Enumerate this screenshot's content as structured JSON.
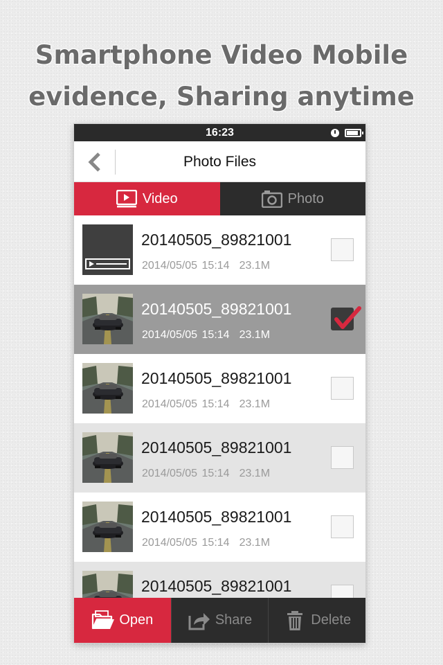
{
  "promo": {
    "line1": "Smartphone Video Mobile",
    "line2": "evidence, Sharing anytime"
  },
  "status_bar": {
    "time": "16:23",
    "icons": [
      "clock-icon",
      "battery-icon"
    ]
  },
  "nav": {
    "back_icon": "chevron-left-icon",
    "title": "Photo Files"
  },
  "tabs": [
    {
      "label": "Video",
      "icon": "video-icon",
      "active": true
    },
    {
      "label": "Photo",
      "icon": "camera-icon",
      "active": false
    }
  ],
  "files": [
    {
      "name": "20140505_89821001",
      "date": "2014/05/05 15:14",
      "size": "23.1M",
      "thumbnail": "video-placeholder",
      "checked": false
    },
    {
      "name": "20140505_89821001",
      "date": "2014/05/05 15:14",
      "size": "23.1M",
      "thumbnail": "car-photo",
      "checked": true
    },
    {
      "name": "20140505_89821001",
      "date": "2014/05/05 15:14",
      "size": "23.1M",
      "thumbnail": "car-photo",
      "checked": false
    },
    {
      "name": "20140505_89821001",
      "date": "2014/05/05 15:14",
      "size": "23.1M",
      "thumbnail": "car-photo",
      "checked": false
    },
    {
      "name": "20140505_89821001",
      "date": "2014/05/05 15:14",
      "size": "23.1M",
      "thumbnail": "car-photo",
      "checked": false
    },
    {
      "name": "20140505_89821001",
      "date": "",
      "size": "",
      "thumbnail": "car-photo",
      "checked": false
    }
  ],
  "toolbar": {
    "open_label": "Open",
    "share_label": "Share",
    "delete_label": "Delete"
  },
  "colors": {
    "accent": "#d7283f",
    "dark": "#2c2c2c",
    "selected_row": "#9b9b9b"
  }
}
